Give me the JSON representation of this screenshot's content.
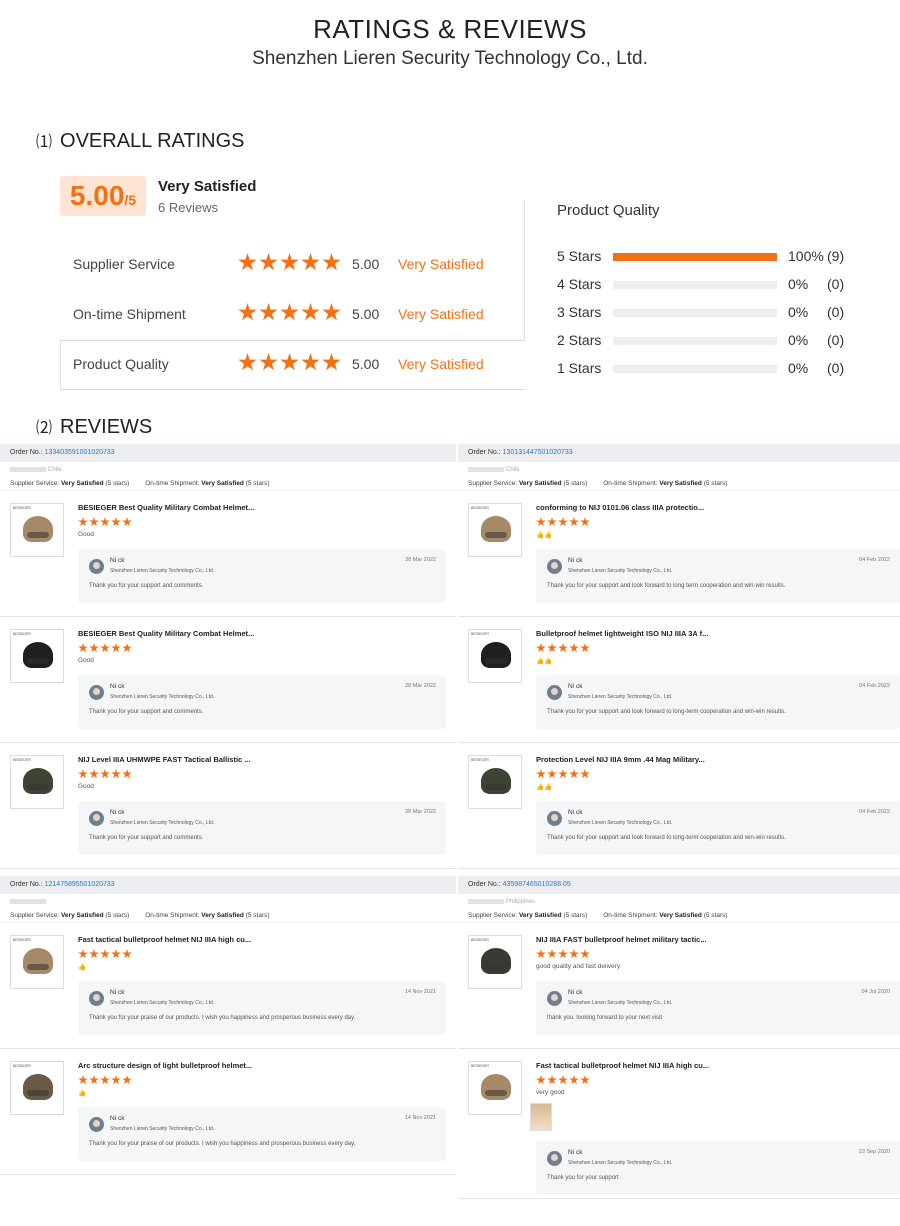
{
  "header": {
    "title": "RATINGS & REVIEWS",
    "subtitle": "Shenzhen Lieren Security Technology Co., Ltd."
  },
  "overall": {
    "section_num": "⑴",
    "section_title": "OVERALL RATINGS",
    "score": "5.00",
    "score_out_of": "/5",
    "summary": "Very Satisfied",
    "review_count": "6 Reviews",
    "rows": [
      {
        "label": "Supplier Service",
        "stars": 5,
        "value": "5.00",
        "text": "Very Satisfied"
      },
      {
        "label": "On-time Shipment",
        "stars": 5,
        "value": "5.00",
        "text": "Very Satisfied"
      },
      {
        "label": "Product Quality",
        "stars": 5,
        "value": "5.00",
        "text": "Very Satisfied"
      }
    ],
    "product_quality": {
      "title": "Product Quality",
      "rows": [
        {
          "label": "5  Stars",
          "fraction": 1.0,
          "pct": "100%",
          "count": "(9)"
        },
        {
          "label": "4  Stars",
          "fraction": 0,
          "pct": "0%",
          "count": "(0)"
        },
        {
          "label": "3  Stars",
          "fraction": 0,
          "pct": "0%",
          "count": "(0)"
        },
        {
          "label": "2  Stars",
          "fraction": 0,
          "pct": "0%",
          "count": "(0)"
        },
        {
          "label": "1  Stars",
          "fraction": 0,
          "pct": "0%",
          "count": "(0)"
        }
      ]
    }
  },
  "reviews": {
    "section_num": "⑵",
    "section_title": "REVIEWS",
    "orders": [
      {
        "order_label": "Order No.:",
        "order_no": "133403591001020733",
        "country": "Chile",
        "svc_label": "Supplier Service:",
        "svc_val": "Very Satisfied",
        "svc_stars": "(5 stars)",
        "ship_label": "On-time Shipment:",
        "ship_val": "Very Satisfied",
        "ship_stars": "(5 stars)",
        "items": [
          {
            "name": "BESIEGER Best Quality Military Combat Helmet...",
            "text": "Good",
            "helmet_color": "#a68a68",
            "reply_name": "Ni ck",
            "reply_company": "Shenzhen Lieren Security Technology Co., Ltd.",
            "date": "28 Mar 2022",
            "reply_msg": "Thank you for your support and comments."
          },
          {
            "name": "BESIEGER Best Quality Military Combat Helmet...",
            "text": "Good",
            "helmet_color": "#1f1f22",
            "reply_name": "Ni ck",
            "reply_company": "Shenzhen Lieren Security Technology Co., Ltd.",
            "date": "28 Mar 2022",
            "reply_msg": "Thank you for your support and comments."
          },
          {
            "name": "NIJ Level IIIA UHMWPE FAST Tactical Ballistic ...",
            "text": "Good",
            "helmet_color": "#3d4434",
            "reply_name": "Ni ck",
            "reply_company": "Shenzhen Lieren Security Technology Co., Ltd.",
            "date": "28 Mar 2022",
            "reply_msg": "Thank you for your support and comments."
          }
        ]
      },
      {
        "order_label": "Order No.:",
        "order_no": "130131447501020733",
        "country": "Chile",
        "svc_label": "Supplier Service:",
        "svc_val": "Very Satisfied",
        "svc_stars": "(5 stars)",
        "ship_label": "On-time Shipment:",
        "ship_val": "Very Satisfied",
        "ship_stars": "(5 stars)",
        "items": [
          {
            "name": "conforming to NIJ 0101.06 class IIIA protectio...",
            "text": "👍👍",
            "helmet_color": "#a68a68",
            "reply_name": "Ni ck",
            "reply_company": "Shenzhen Lieren Security Technology Co., Ltd.",
            "date": "04 Feb 2022",
            "reply_msg": "Thank you for your support and look forward to long term cooperation and win-win results."
          },
          {
            "name": "Bulletproof helmet lightweight ISO NIJ IIIA 3A f...",
            "text": "👍👍",
            "helmet_color": "#1f1f22",
            "reply_name": "Ni ck",
            "reply_company": "Shenzhen Lieren Security Technology Co., Ltd.",
            "date": "04 Feb 2022",
            "reply_msg": "Thank you for your support and look forward to long-term cooperation and win-win results."
          },
          {
            "name": "Protection Level NIJ IIIA 9mm .44 Mag Military...",
            "text": "👍👍",
            "helmet_color": "#3d4434",
            "reply_name": "Ni ck",
            "reply_company": "Shenzhen Lieren Security Technology Co., Ltd.",
            "date": "04 Feb 2022",
            "reply_msg": "Thank you for your support and look forward to long-term cooperation and win-win results."
          }
        ]
      },
      {
        "order_label": "Order No.:",
        "order_no": "121475895501020733",
        "country": "",
        "svc_label": "Supplier Service:",
        "svc_val": "Very Satisfied",
        "svc_stars": "(5 stars)",
        "ship_label": "On-time Shipment:",
        "ship_val": "Very Satisfied",
        "ship_stars": "(5 stars)",
        "items": [
          {
            "name": "Fast tactical bulletproof helmet NIJ IIIA high cu...",
            "text": "👍",
            "helmet_color": "#a68a68",
            "reply_name": "Ni ck",
            "reply_company": "Shenzhen Lieren Security Technology Co., Ltd.",
            "date": "14 Nov 2021",
            "reply_msg": "Thank you for your praise of our products. I wish you happiness and prosperous business every day."
          },
          {
            "name": "Arc structure design of light bulletproof helmet...",
            "text": "👍",
            "helmet_color": "#6b5a44",
            "reply_name": "Ni ck",
            "reply_company": "Shenzhen Lieren Security Technology Co., Ltd.",
            "date": "14 Nov 2021",
            "reply_msg": "Thank you for your praise of our products. I wish you happiness and prosperous business every day."
          }
        ]
      },
      {
        "order_label": "Order No.:",
        "order_no": "435987465010288 05",
        "country": "Philippines",
        "svc_label": "Supplier Service:",
        "svc_val": "Very Satisfied",
        "svc_stars": "(5 stars)",
        "ship_label": "On-time Shipment:",
        "ship_val": "Very Satisfied",
        "ship_stars": "(5 stars)",
        "items": [
          {
            "name": "NIJ IIIA FAST bulletproof helmet military tactic...",
            "text": "good quality and fast delivery",
            "helmet_color": "#3a3a34",
            "reply_name": "Ni ck",
            "reply_company": "Shenzhen Lieren Security Technology Co., Ltd.",
            "date": "04 Jul 2020",
            "reply_msg": "thank you. looking forward to your next visit"
          },
          {
            "name": "Fast tactical bulletproof helmet NIJ IIIA high cu...",
            "text": "very good",
            "helmet_color": "#a68a68",
            "reply_name": "Ni ck",
            "reply_company": "Shenzhen Lieren Security Technology Co., Ltd.",
            "date": "23 Sep 2020",
            "reply_msg": "Thank you for your support"
          }
        ]
      }
    ]
  }
}
